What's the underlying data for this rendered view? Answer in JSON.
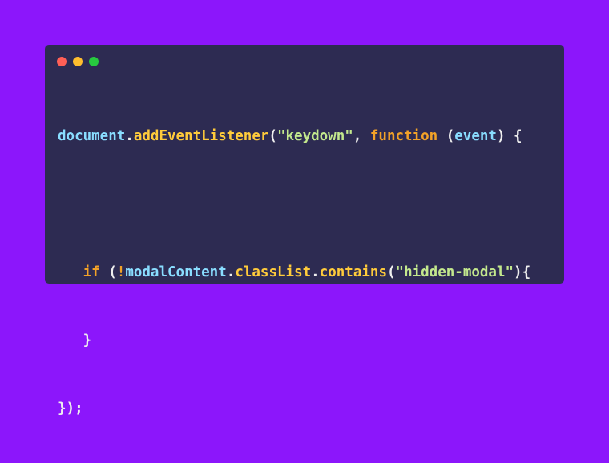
{
  "window_controls": {
    "close_color": "#ff5f56",
    "minimize_color": "#ffbd2e",
    "maximize_color": "#27c93f"
  },
  "code": {
    "line1": {
      "obj": "document",
      "dot": ".",
      "method": "addEventListener",
      "open": "(",
      "str": "\"keydown\"",
      "comma": ", ",
      "kw": "function",
      "space": " ",
      "paren_open": "(",
      "param": "event",
      "rest": ") {"
    },
    "line3": {
      "indent": "   ",
      "kw": "if",
      "space": " ",
      "paren": "(",
      "bang": "!",
      "obj": "modalContent",
      "dot1": ".",
      "prop": "classList",
      "dot2": ".",
      "method": "contains",
      "open": "(",
      "str": "\"hidden-modal\"",
      "rest": "){"
    },
    "line4": {
      "text": "   }"
    },
    "line5": {
      "text": "});"
    }
  }
}
